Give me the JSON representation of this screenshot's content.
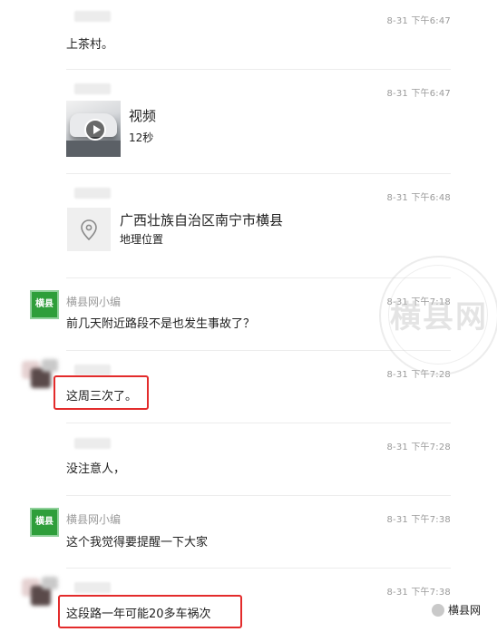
{
  "messages": [
    {
      "time": "8-31 下午6:47",
      "text": "上茶村。"
    },
    {
      "time": "8-31 下午6:47",
      "video_title": "视频",
      "video_duration": "12秒"
    },
    {
      "time": "8-31 下午6:48",
      "location_title": "广西壮族自治区南宁市横县",
      "location_sub": "地理位置"
    },
    {
      "time": "8-31 下午7:18",
      "sender": "横县网小编",
      "avatar_text": "横县网",
      "text": "前几天附近路段不是也发生事故了？"
    },
    {
      "time": "8-31 下午7:28",
      "text": "这周三次了。"
    },
    {
      "time": "8-31 下午7:28",
      "text": "没注意人，"
    },
    {
      "time": "8-31 下午7:38",
      "sender": "横县网小编",
      "avatar_text": "横县网",
      "text": "这个我觉得要提醒一下大家"
    },
    {
      "time": "8-31 下午7:38",
      "text": "这段路一年可能20多车祸次"
    }
  ],
  "watermark": {
    "text": "横县网"
  },
  "logo": {
    "text": "横县网"
  },
  "colors": {
    "highlight": "#e32b2b",
    "avatar_green": "#2e9e3a"
  }
}
